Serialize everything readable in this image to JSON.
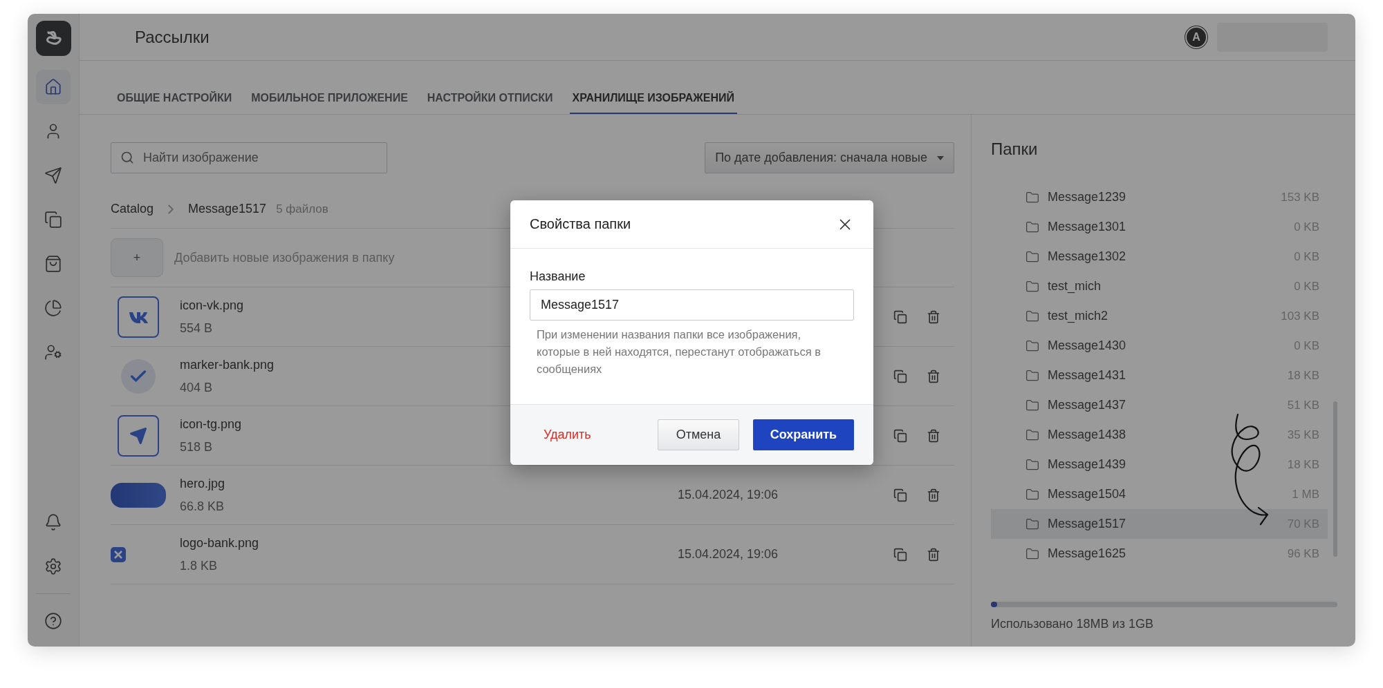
{
  "header": {
    "title": "Рассылки",
    "avatar_initial": "A"
  },
  "sidebar": {
    "items": [
      {
        "selected": true
      },
      {
        "selected": false
      },
      {
        "selected": false
      },
      {
        "selected": false
      },
      {
        "selected": false
      },
      {
        "selected": false
      },
      {
        "selected": false
      }
    ],
    "bottom_items": [
      {
        "selected": false
      },
      {
        "selected": false
      },
      {
        "selected": false
      }
    ]
  },
  "tabs": [
    {
      "label": "ОБЩИЕ НАСТРОЙКИ",
      "selected": false
    },
    {
      "label": "МОБИЛЬНОЕ ПРИЛОЖЕНИЕ",
      "selected": false
    },
    {
      "label": "НАСТРОЙКИ ОТПИСКИ",
      "selected": false
    },
    {
      "label": "ХРАНИЛИЩЕ ИЗОБРАЖЕНИЙ",
      "selected": true
    }
  ],
  "search": {
    "placeholder": "Найти изображение"
  },
  "sort": {
    "value": "По дате добавления: сначала новые"
  },
  "breadcrumb": {
    "items": [
      "Catalog",
      "Message1517"
    ],
    "count": "5 файлов"
  },
  "add_images": {
    "button": "+",
    "label": "Добавить новые изображения в папку"
  },
  "files": [
    {
      "kind": "vk",
      "name": "icon-vk.png",
      "size": "554 B"
    },
    {
      "kind": "check",
      "name": "marker-bank.png",
      "size": "404 B"
    },
    {
      "kind": "tg",
      "name": "icon-tg.png",
      "size": "518 B"
    },
    {
      "kind": "photo",
      "name": "hero.jpg",
      "size": "66.8 KB",
      "date": "15.04.2024, 19:06"
    },
    {
      "kind": "logo",
      "name": "logo-bank.png",
      "size": "1.8 KB",
      "date": "15.04.2024, 19:06"
    }
  ],
  "folders": {
    "title": "Папки",
    "items": [
      {
        "name": "Message1239",
        "size": "153 KB",
        "selected": false
      },
      {
        "name": "Message1301",
        "size": "0 KB",
        "selected": false
      },
      {
        "name": "Message1302",
        "size": "0 KB",
        "selected": false
      },
      {
        "name": "test_mich",
        "size": "0 KB",
        "selected": false
      },
      {
        "name": "test_mich2",
        "size": "103 KB",
        "selected": false
      },
      {
        "name": "Message1430",
        "size": "0 KB",
        "selected": false
      },
      {
        "name": "Message1431",
        "size": "18 KB",
        "selected": false
      },
      {
        "name": "Message1437",
        "size": "51 KB",
        "selected": false
      },
      {
        "name": "Message1438",
        "size": "35 KB",
        "selected": false
      },
      {
        "name": "Message1439",
        "size": "18 KB",
        "selected": false
      },
      {
        "name": "Message1504",
        "size": "1 MB",
        "selected": false
      },
      {
        "name": "Message1517",
        "size": "70 KB",
        "selected": true
      },
      {
        "name": "Message1625",
        "size": "96 KB",
        "selected": false
      }
    ],
    "usage": {
      "level": 0.018,
      "text": "Использовано 18MB из 1GB"
    }
  },
  "dialog": {
    "title": "Свойства папки",
    "field_label": "Название",
    "field_value": "Message1517",
    "hint": "При изменении названия папки все изображения, которые в ней находятся, перестанут отображаться в сообщениях",
    "delete": "Удалить",
    "cancel": "Отмена",
    "save": "Сохранить"
  }
}
